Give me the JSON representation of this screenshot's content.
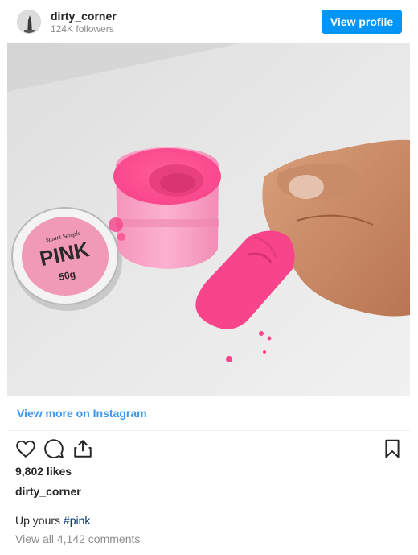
{
  "header": {
    "username": "dirty_corner",
    "followers": "124K followers",
    "view_profile_label": "View profile",
    "accent_color": "#0095f6"
  },
  "post": {
    "image_icon": "photo-image",
    "jar_label": {
      "brand": "Stuart Semple",
      "product": "PINK",
      "weight": "50g"
    }
  },
  "view_more_label": "View more on Instagram",
  "actions": {
    "icons": [
      "heart-icon",
      "comment-icon",
      "share-icon",
      "bookmark-icon"
    ]
  },
  "likes": "9,802 likes",
  "owner": "dirty_corner",
  "caption": {
    "text": "Up yours ",
    "hashtag": "#pink"
  },
  "comments_link": "View all 4,142 comments"
}
